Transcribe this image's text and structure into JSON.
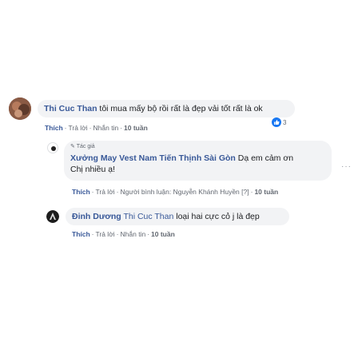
{
  "comments": [
    {
      "author": "Thi Cuc Than",
      "text": "tôi mua mấy bộ rồi rất là đẹp vải tốt rất là ok",
      "actions": {
        "like": "Thích",
        "reply": "Trả lời",
        "message": "Nhắn tin",
        "time": "10 tuần"
      },
      "reaction_count": "3",
      "reaction_icon": "like-icon",
      "reaction_color": "#1877f2"
    },
    {
      "author_badge": "Tác giả",
      "author": "Xưởng May Vest Nam Tiến Thịnh Sài Gòn",
      "text_line1": "Dạ em cảm ơn",
      "text_line2": "Chị nhiều ạ!",
      "actions": {
        "like": "Thích",
        "reply": "Trả lời",
        "responder_label": "Người bình luận:",
        "responder_name": "Nguyễn Khánh Huyền",
        "responder_tag": "[?]",
        "time": "10 tuần"
      },
      "more_icon": "more-dots-icon"
    },
    {
      "author": "Đinh Dương",
      "tagged": "Thi Cuc Than",
      "text": "loại hai cực cỏ j là đẹp",
      "actions": {
        "like": "Thích",
        "reply": "Trả lời",
        "message": "Nhắn tin",
        "time": "10 tuần"
      }
    }
  ]
}
